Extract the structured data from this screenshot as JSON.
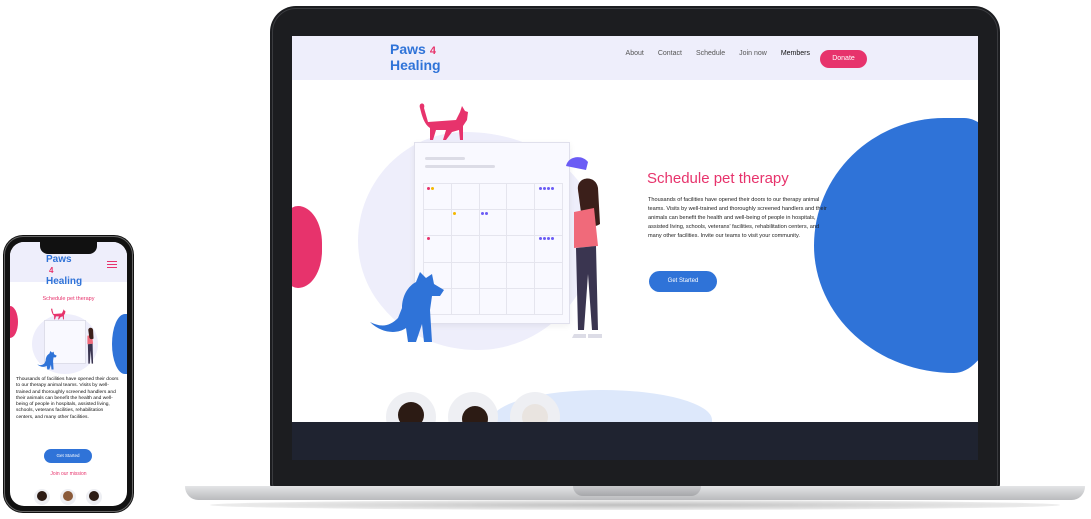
{
  "brand": {
    "line1": "Paws",
    "number": "4",
    "line2": "Healing"
  },
  "nav": {
    "items": [
      "About",
      "Contact",
      "Schedule",
      "Join now",
      "Members"
    ],
    "donate": "Donate"
  },
  "hero": {
    "title": "Schedule pet therapy",
    "body": "Thousands of facilities have opened their doors to our therapy animal teams. Visits by well-trained and thoroughly screened handlers and their animals can benefit the health and well-being of people in hospitals, assisted living, schools, veterans' facilities, rehabilitation centers, and many other facilities. Invite our teams to visit your community.",
    "cta": "Get Started"
  },
  "mobile": {
    "title": "Schedule pet therapy",
    "body": "Thousands of facilities have opened their doors to our therapy animal teams. Visits by well-trained and thoroughly screened handlers and their animals can benefit the health and well-being of people in hospitals, assisted living, schools, veterans facilities, rehabilitation centers, and many other facilities.",
    "cta": "Get Started",
    "link": "Join our mission"
  },
  "icons": {
    "menu": "hamburger-menu-icon",
    "cat": "cat-illustration",
    "dog": "dog-illustration",
    "person": "woman-illustration"
  },
  "colors": {
    "accent_pink": "#e7336c",
    "accent_blue": "#2f73d8",
    "lilac": "#eeeefb",
    "footer": "#1f2330"
  }
}
